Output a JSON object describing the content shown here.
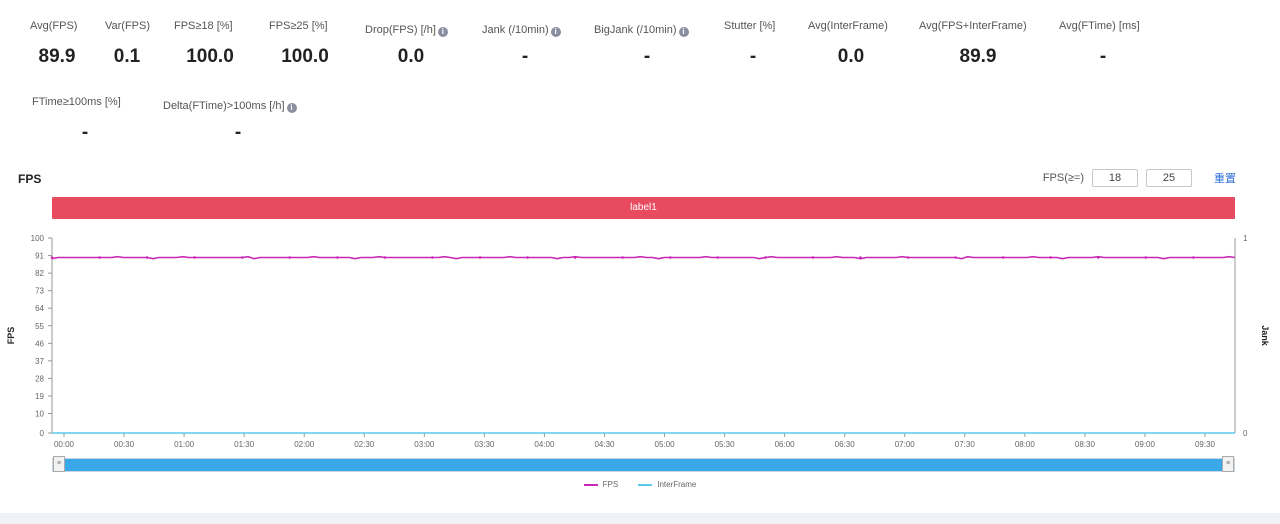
{
  "stats_row1": [
    {
      "label": "Avg(FPS)",
      "value": "89.9",
      "info": false
    },
    {
      "label": "Var(FPS)",
      "value": "0.1",
      "info": false
    },
    {
      "label": "FPS≥18 [%]",
      "value": "100.0",
      "info": false
    },
    {
      "label": "FPS≥25 [%]",
      "value": "100.0",
      "info": false
    },
    {
      "label": "Drop(FPS) [/h]",
      "value": "0.0",
      "info": true
    },
    {
      "label": "Jank (/10min)",
      "value": "-",
      "info": true
    },
    {
      "label": "BigJank (/10min)",
      "value": "-",
      "info": true
    },
    {
      "label": "Stutter [%]",
      "value": "-",
      "info": false
    },
    {
      "label": "Avg(InterFrame)",
      "value": "0.0",
      "info": false
    },
    {
      "label": "Avg(FPS+InterFrame)",
      "value": "89.9",
      "info": false
    },
    {
      "label": "Avg(FTime) [ms]",
      "value": "-",
      "info": false
    }
  ],
  "stats_row2": [
    {
      "label": "FTime≥100ms [%]",
      "value": "-",
      "info": false
    },
    {
      "label": "Delta(FTime)>100ms [/h]",
      "value": "-",
      "info": true
    }
  ],
  "section_title": "FPS",
  "threshold": {
    "label": "FPS(≥=)",
    "value1": "18",
    "value2": "25",
    "link": "重置"
  },
  "label_bar": "label1",
  "chart_data": {
    "type": "line",
    "title": "",
    "ylabel": "FPS",
    "y2label": "Jank",
    "ylim": [
      0,
      100
    ],
    "y2lim": [
      0,
      1
    ],
    "yticks": [
      0,
      10,
      19,
      28,
      37,
      46,
      55,
      64,
      73,
      82,
      91,
      100
    ],
    "y2ticks": [
      0,
      1
    ],
    "xticks": [
      "00:00",
      "00:30",
      "01:00",
      "01:30",
      "02:00",
      "02:30",
      "03:00",
      "03:30",
      "04:00",
      "04:30",
      "05:00",
      "05:30",
      "06:00",
      "06:30",
      "07:00",
      "07:30",
      "08:00",
      "08:30",
      "09:00",
      "09:30"
    ],
    "grid": false,
    "legend": "bottom",
    "series": [
      {
        "name": "FPS",
        "color": "#c828b4",
        "values": [
          90,
          90,
          90,
          90,
          90,
          90,
          90,
          90,
          90,
          90,
          90,
          90,
          90,
          90,
          90,
          90,
          90,
          90,
          90,
          90,
          90,
          90,
          90,
          90,
          90,
          90,
          90,
          90,
          90,
          90,
          90,
          90,
          90,
          90,
          90,
          90,
          90,
          90,
          90,
          90,
          90,
          90,
          90,
          90,
          90,
          90,
          90,
          90,
          90,
          90,
          90,
          90,
          90,
          90,
          90,
          90,
          90,
          90,
          90,
          90,
          90,
          90,
          90,
          90,
          90,
          90,
          90,
          90,
          90,
          90,
          90,
          90,
          90,
          90,
          90,
          90,
          90,
          90,
          90,
          90,
          90,
          90,
          90,
          90,
          90,
          90,
          90,
          90,
          90,
          90,
          90,
          90,
          90,
          90,
          90,
          90,
          90,
          90,
          90,
          90,
          90,
          90,
          90,
          90,
          90,
          90,
          90,
          90,
          90,
          90,
          90,
          90,
          90,
          90,
          90,
          90,
          90,
          90,
          90,
          90,
          90,
          90,
          90,
          90,
          90,
          90,
          90,
          90,
          90,
          90,
          90,
          90,
          90,
          90,
          90,
          90,
          90,
          90,
          90,
          90,
          90,
          90,
          90,
          90,
          90,
          90,
          90,
          90,
          90,
          90,
          90,
          90,
          90,
          90,
          90,
          90,
          90,
          90,
          90,
          90,
          90,
          90,
          90,
          90,
          90,
          90,
          90,
          90,
          90,
          90,
          90,
          90,
          90,
          90,
          90,
          90,
          90,
          90,
          90,
          90,
          90,
          90,
          90,
          90,
          90,
          90,
          90,
          90,
          90,
          90,
          90,
          90,
          90,
          90,
          90,
          90,
          90,
          90,
          90,
          90
        ]
      },
      {
        "name": "InterFrame",
        "color": "#5bc8e8",
        "values": [
          0,
          0
        ]
      }
    ]
  }
}
